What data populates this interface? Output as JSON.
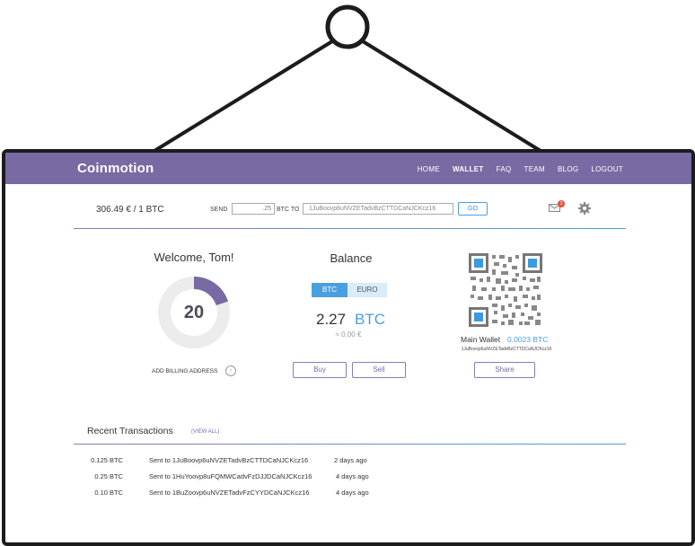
{
  "header": {
    "logo": "Coinmotion",
    "nav": [
      "HOME",
      "WALLET",
      "FAQ",
      "TEAM",
      "BLOG",
      "LOGOUT"
    ],
    "active_nav": "WALLET",
    "brand_color": "#7a6aa3"
  },
  "send_bar": {
    "rate": "306.49 € / 1 BTC",
    "send_label": "SEND",
    "amount_value": ".25",
    "btc_to_label": "BTC TO",
    "address_value": "1JuBoovp6uNVZETadvBzCTTDCaNJCKcz16",
    "go_label": "GO",
    "mail_count": "3",
    "accent_color": "#4aa0de"
  },
  "welcome": {
    "title": "Welcome, Tom!",
    "level": "20",
    "billing_label": "ADD BILLING ADDRESS"
  },
  "balance": {
    "title": "Balance",
    "tab_btc": "BTC",
    "tab_euro": "EURO",
    "amount": "2.27",
    "currency": "BTC",
    "eur_equiv": "≈ 0.00 €",
    "buy_label": "Buy",
    "sell_label": "Sell"
  },
  "wallet": {
    "name": "Main Wallet",
    "amount": "0.0023 BTC",
    "address": "1JuBoovp6uNVZETadvBzCTTDCaNJCKcz16",
    "share_label": "Share"
  },
  "transactions": {
    "title": "Recent Transactions",
    "view_all": "(VIEW ALL)",
    "rows": [
      {
        "amount": "0.125 BTC",
        "sent": "Sent to  1JuBoovp6uNVZETadvBzCTTDCaNJCKcz16",
        "when": "2 days ago"
      },
      {
        "amount": "0.25 BTC",
        "sent": "Sent to  1HuYoovp8uFQMWCadvFzDJJDCaNJCKcz16",
        "when": "4 days ago"
      },
      {
        "amount": "0.10 BTC",
        "sent": "Sent to  1BuZoovp6uNVZETadvFzCYYDCaNJCKcz16",
        "when": "4 days ago"
      }
    ]
  }
}
